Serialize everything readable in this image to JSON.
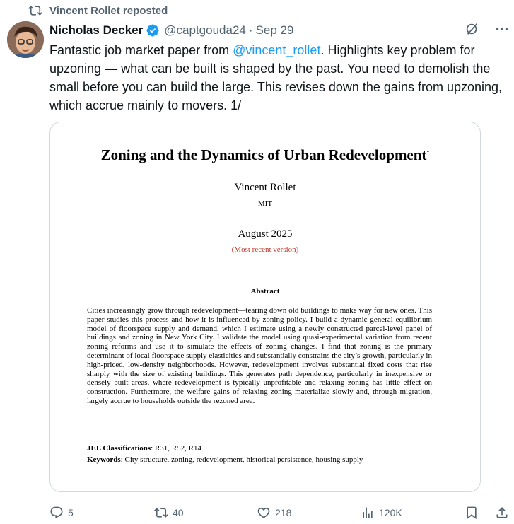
{
  "repost": {
    "text": "Vincent Rollet reposted",
    "icon": "repost-icon"
  },
  "author": {
    "name": "Nicholas Decker",
    "verified": true,
    "handle": "@captgouda24",
    "separator": "·",
    "date": "Sep 29"
  },
  "tweet": {
    "before_mention": "Fantastic job market paper from ",
    "mention": "@vincent_rollet",
    "after_mention": ". Highlights key problem for upzoning — what can be built is shaped by the past. You need to demolish the small before you can build the large. This revises down the gains from upzoning, which accrue mainly to movers. 1/"
  },
  "paper": {
    "title": "Zoning and the Dynamics of Urban Redevelopment",
    "title_mark": "*",
    "author": "Vincent Rollet",
    "affiliation": "MIT",
    "date": "August 2025",
    "version_link": "(Most recent version)",
    "abstract_heading": "Abstract",
    "abstract": "Cities increasingly grow through redevelopment—tearing down old buildings to make way for new ones. This paper studies this process and how it is influenced by zoning policy. I build a dynamic general equilibrium model of floorspace supply and demand, which I estimate using a newly constructed parcel-level panel of buildings and zoning in New York City. I validate the model using quasi-experimental variation from recent zoning reforms and use it to simulate the effects of zoning changes. I find that zoning is the primary determinant of local floorspace supply elasticities and substantially constrains the city’s growth, particularly in high-priced, low-density neighborhoods. However, redevelopment involves substantial fixed costs that rise sharply with the size of existing buildings. This generates path dependence, particularly in inexpensive or densely built areas, where redevelopment is typically unprofitable and relaxing zoning has little effect on construction. Furthermore, the welfare gains of relaxing zoning materialize slowly and, through migration, largely accrue to households outside the rezoned area.",
    "jel_label": "JEL Classifications",
    "jel_value": ": R31, R52, R14",
    "keywords_label": "Keywords",
    "keywords_value": ": City structure, zoning, redevelopment, historical persistence, housing supply",
    "version_color": "#c0392b"
  },
  "actions": {
    "replies": "5",
    "reposts": "40",
    "likes": "218",
    "views": "120K"
  },
  "colors": {
    "accent": "#1d9bf0",
    "muted": "#536471",
    "text": "#0f1419"
  }
}
